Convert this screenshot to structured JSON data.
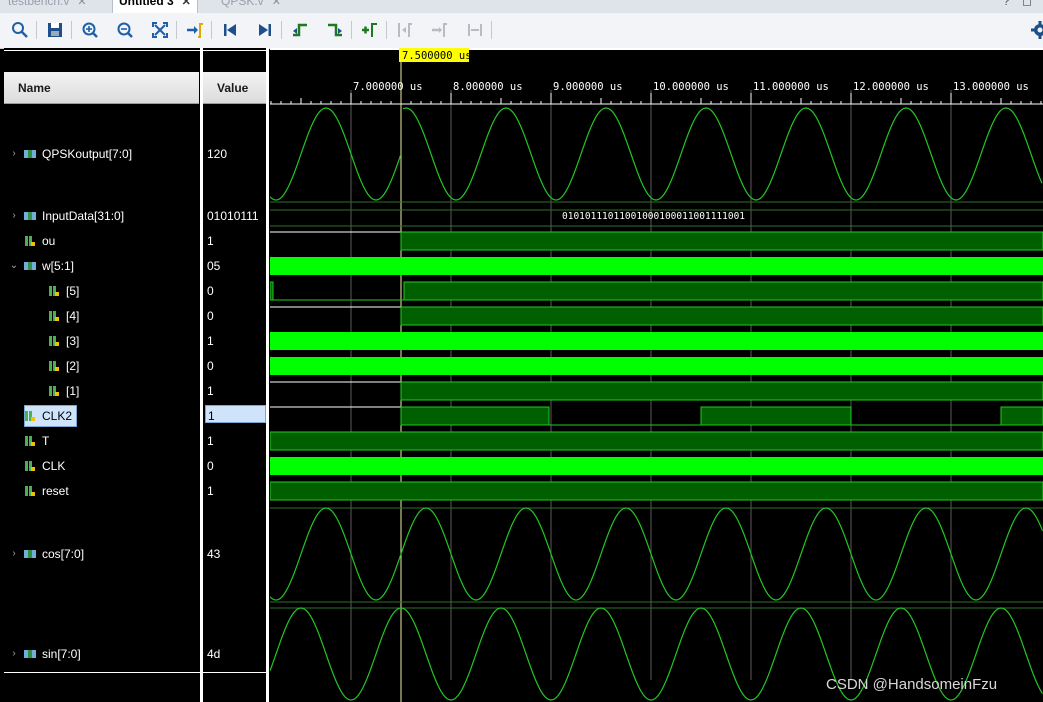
{
  "tabs": [
    {
      "label": "testbench.v"
    },
    {
      "label": "Untitled 3"
    },
    {
      "label": "QPSK.v"
    }
  ],
  "tab_close_glyph": "✕",
  "window_controls": {
    "help": "?",
    "maximize": "◻"
  },
  "toolbar": {
    "buttons": [
      "search-icon",
      "save-icon",
      "zoom-in-icon",
      "zoom-out-icon",
      "zoom-fit-icon",
      "go-to-cursor-icon",
      "go-to-time-0-icon",
      "go-to-last-time-icon",
      "previous-transition-icon",
      "next-transition-icon",
      "add-marker-icon",
      "previous-marker-icon",
      "next-marker-icon",
      "swap-cursors-icon",
      "settings-icon"
    ]
  },
  "columns": {
    "name": "Name",
    "value": "Value"
  },
  "cursor_time": "7.500000 us",
  "time_ticks": [
    "7.000000 us",
    "8.000000 us",
    "9.000000 us",
    "10.000000 us",
    "11.000000 us",
    "12.000000 us",
    "13.000000 us"
  ],
  "signals": [
    {
      "name": "QPSKoutput[7:0]",
      "value": "120",
      "kind": "analog-bus",
      "expandable": true
    },
    {
      "name": "InputData[31:0]",
      "value": "01010111",
      "kind": "bus",
      "expandable": true,
      "bus_text": "01010111011001000100011001111001"
    },
    {
      "name": "ou",
      "value": "1",
      "kind": "bit"
    },
    {
      "name": "w[5:1]",
      "value": "05",
      "kind": "bus",
      "expandable": true,
      "expanded": true
    },
    {
      "name": "[5]",
      "value": "0",
      "kind": "bit",
      "indent": true
    },
    {
      "name": "[4]",
      "value": "0",
      "kind": "bit",
      "indent": true
    },
    {
      "name": "[3]",
      "value": "1",
      "kind": "bit",
      "indent": true
    },
    {
      "name": "[2]",
      "value": "0",
      "kind": "bit",
      "indent": true
    },
    {
      "name": "[1]",
      "value": "1",
      "kind": "bit",
      "indent": true
    },
    {
      "name": "CLK2",
      "value": "1",
      "kind": "bit",
      "selected": true
    },
    {
      "name": "T",
      "value": "1",
      "kind": "bit"
    },
    {
      "name": "CLK",
      "value": "0",
      "kind": "bit"
    },
    {
      "name": "reset",
      "value": "1",
      "kind": "bit"
    },
    {
      "name": "cos[7:0]",
      "value": "43",
      "kind": "analog-bus",
      "expandable": true
    },
    {
      "name": "sin[7:0]",
      "value": "4d",
      "kind": "analog-bus",
      "expandable": true
    }
  ],
  "watermark": "CSDN @HandsomeinFzu",
  "colors": {
    "wave_high": "#00ff00",
    "wave_fill": "#006000",
    "wave_line": "#22c822",
    "grid": "#2e6e2e",
    "cursor_label_bg": "#ffff00"
  }
}
